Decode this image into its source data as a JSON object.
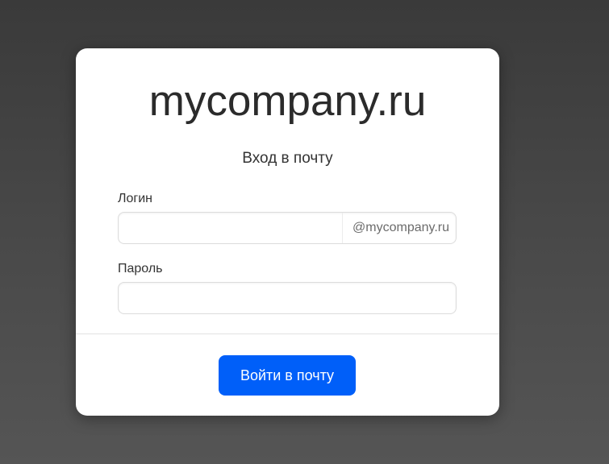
{
  "card": {
    "title": "mycompany.ru",
    "subtitle": "Вход в почту"
  },
  "login": {
    "label": "Логин",
    "value": "",
    "placeholder": "",
    "domain_suffix": "@mycompany.ru"
  },
  "password": {
    "label": "Пароль",
    "value": "",
    "placeholder": ""
  },
  "submit": {
    "label": "Войти в почту"
  },
  "colors": {
    "accent": "#005ff9",
    "background": "#474747",
    "card": "#ffffff"
  }
}
